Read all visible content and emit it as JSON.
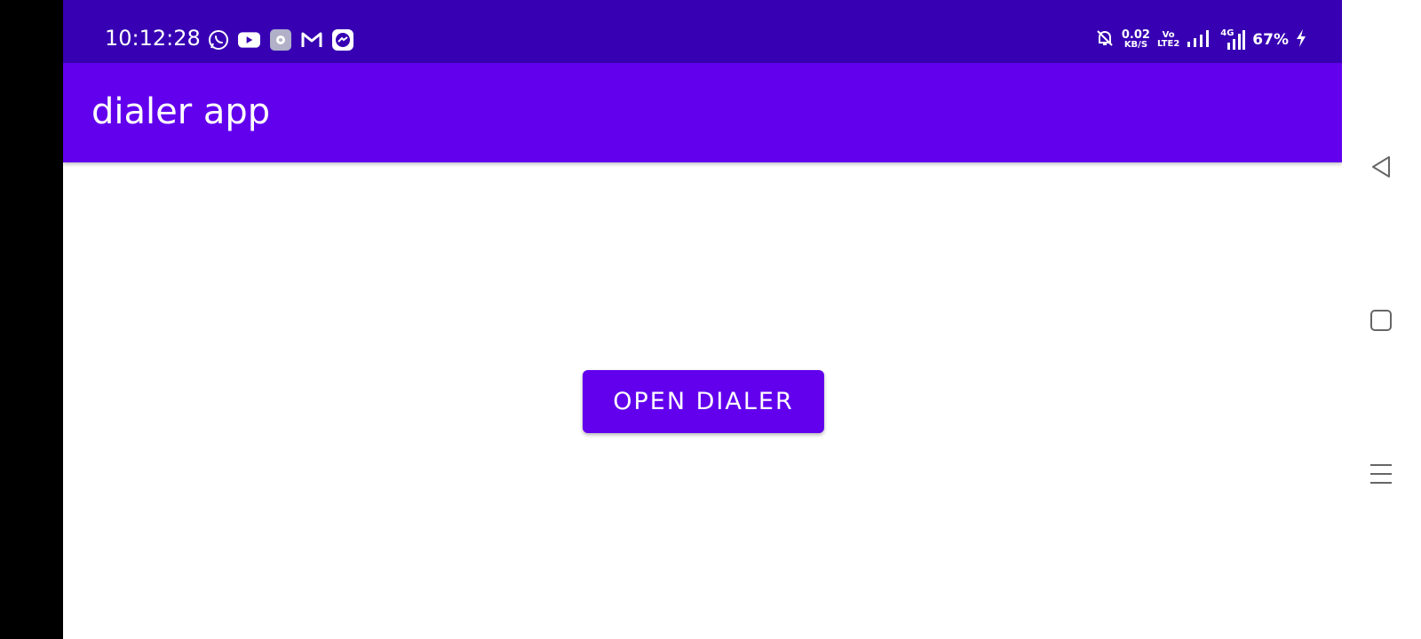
{
  "status_bar": {
    "time": "10:12:28",
    "notification_icons": [
      "whatsapp-icon",
      "youtube-icon",
      "settings-app-icon",
      "gmail-icon",
      "messenger-icon"
    ],
    "net_speed_value": "0.02",
    "net_speed_unit": "KB/S",
    "volte_top": "Vo",
    "volte_bottom": "LTE2",
    "network_type": "4G",
    "battery": "67%",
    "icons": [
      "mute-bell-icon",
      "signal-icon",
      "signal-4g-icon",
      "charging-icon"
    ]
  },
  "app_bar": {
    "title": "dialer app"
  },
  "main": {
    "open_dialer_label": "OPEN DIALER"
  },
  "nav_bar": {
    "icons": [
      "back-icon",
      "home-icon",
      "menu-icon"
    ]
  },
  "colors": {
    "status_bar": "#3700b3",
    "app_bar": "#6200ee",
    "button": "#6200ee",
    "background": "#ffffff"
  }
}
